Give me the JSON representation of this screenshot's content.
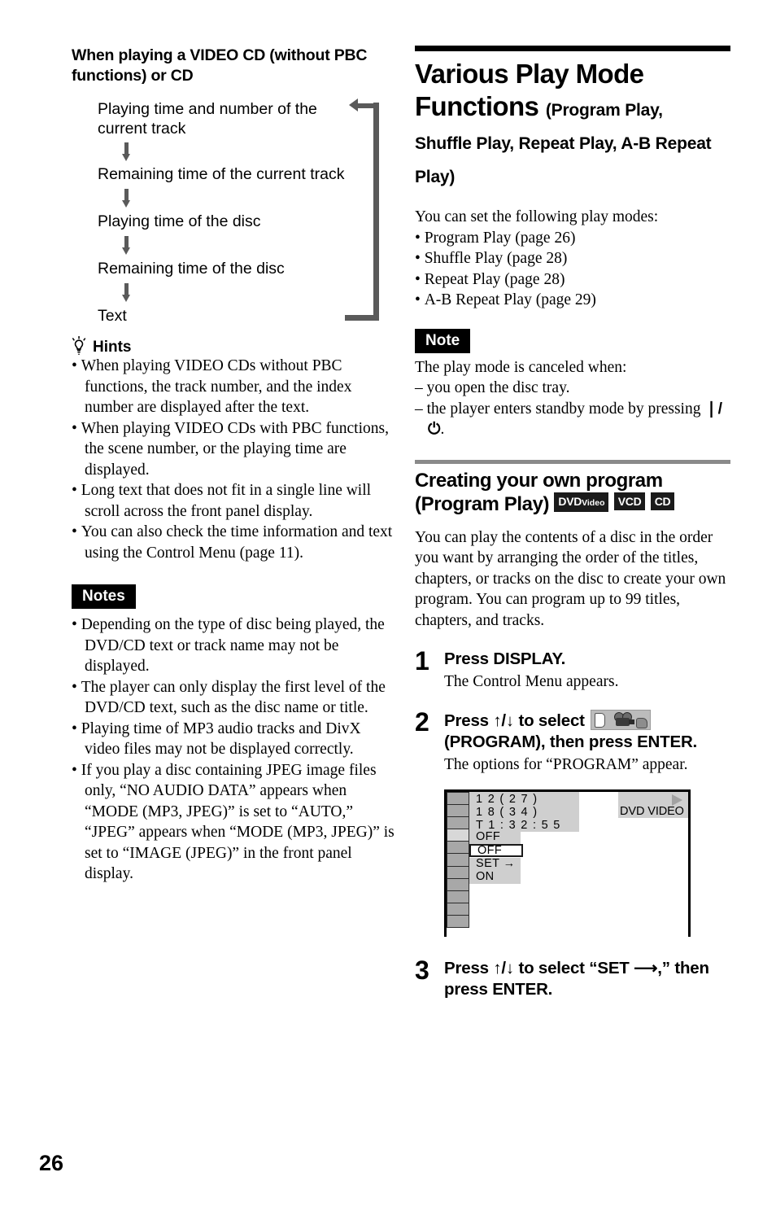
{
  "page_number": "26",
  "left_column": {
    "section_heading": "When playing a VIDEO CD (without PBC functions) or CD",
    "flow_diagram": {
      "steps": [
        "Playing time and number of the current track",
        "Remaining time of the current track",
        "Playing time of the disc",
        "Remaining time of the disc",
        "Text"
      ],
      "loop_back": true
    },
    "hints": {
      "icon": "lightbulb-icon",
      "label": "Hints",
      "items": [
        "When playing VIDEO CDs without PBC functions, the track number, and the index number are displayed after the text.",
        "When playing VIDEO CDs with PBC functions, the scene number, or the playing time are displayed.",
        "Long text that does not fit in a single line will scroll across the front panel display.",
        "You can also check the time information and text using the Control Menu (page 11)."
      ]
    },
    "notes": {
      "label": "Notes",
      "items": [
        "Depending on the type of disc being played, the DVD/CD text or track name may not be displayed.",
        "The player can only display the first level of the DVD/CD text, such as the disc name or title.",
        "Playing time of MP3 audio tracks and DivX video files may not be displayed correctly.",
        "If you play a disc containing JPEG image files only, “NO AUDIO DATA” appears when “MODE (MP3, JPEG)” is set to “AUTO,” “JPEG” appears when “MODE (MP3, JPEG)” is set to “IMAGE (JPEG)” in the front panel display."
      ]
    }
  },
  "right_column": {
    "title_line1": "Various Play Mode",
    "title_line2_bold": "Functions",
    "title_line2_small": "(Program Play,",
    "title_line3": "Shuffle Play, Repeat Play, A-B Repeat",
    "title_line4": "Play)",
    "intro": "You can set the following play modes:",
    "play_modes": [
      "Program Play (page 26)",
      "Shuffle Play (page 28)",
      "Repeat Play (page 28)",
      "A-B Repeat Play (page 29)"
    ],
    "note": {
      "label": "Note",
      "lead": "The play mode is canceled when:",
      "items": [
        "you open the disc tray.",
        "the player enters standby mode by pressing"
      ],
      "power_symbol": "❘/⏻",
      "trailing": "."
    },
    "section": {
      "title_line1": "Creating your own program",
      "title_line2": "(Program Play)",
      "disc_badges": [
        {
          "main": "DVD",
          "sub": "Video"
        },
        {
          "main": "VCD",
          "sub": ""
        },
        {
          "main": "CD",
          "sub": ""
        }
      ],
      "paragraph": "You can play the contents of a disc in the order you want by arranging the order of the titles, chapters, or tracks on the disc to create your own program. You can program up to 99 titles, chapters, and tracks."
    },
    "steps": [
      {
        "num": "1",
        "heading": "Press DISPLAY.",
        "desc": "The Control Menu appears."
      },
      {
        "num": "2",
        "heading_part1": "Press ↑/↓ to select",
        "icon": "program-menu-icon",
        "heading_part2": "(PROGRAM), then press ENTER.",
        "desc": "The options for “PROGRAM” appear."
      },
      {
        "num": "3",
        "heading_part1": "Press ↑/↓ to select “SET ⟶,” then",
        "heading_part2": "press ENTER.",
        "desc": ""
      }
    ],
    "osd": {
      "info_lines": [
        "1 2 ( 2 7 )",
        "1 8 ( 3 4 )",
        "T    1 : 3 2 : 5 5"
      ],
      "options": [
        "OFF",
        "OFF",
        "SET →",
        "ON"
      ],
      "selected_option_index": 1,
      "highlighted_cell_index": 3,
      "disc_label": "DVD VIDEO",
      "play_icon": "play-triangle-icon",
      "cell_count": 11
    }
  }
}
